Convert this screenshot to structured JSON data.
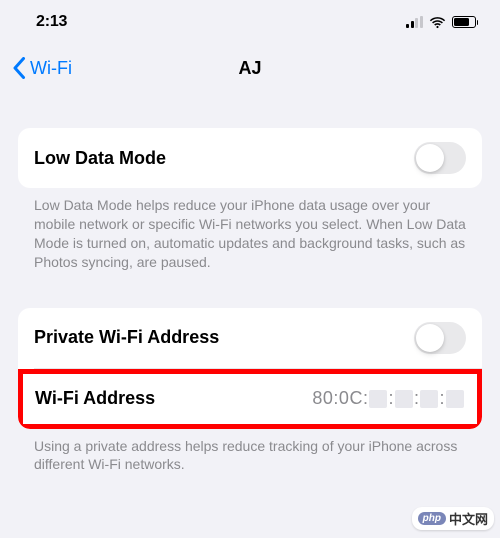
{
  "status": {
    "time": "2:13"
  },
  "nav": {
    "back_label": "Wi-Fi",
    "title": "AJ"
  },
  "sections": {
    "low_data": {
      "label": "Low Data Mode",
      "footer": "Low Data Mode helps reduce your iPhone data usage over your mobile network or specific Wi-Fi networks you select. When Low Data Mode is turned on, automatic updates and background tasks, such as Photos syncing, are paused."
    },
    "private_addr": {
      "label": "Private Wi-Fi Address"
    },
    "wifi_addr": {
      "label": "Wi-Fi Address",
      "value_prefix": "80:0C:",
      "separator": ":"
    },
    "private_footer": "Using a private address helps reduce tracking of your iPhone across different Wi-Fi networks."
  },
  "watermark": {
    "logo": "php",
    "text": "中文网"
  }
}
